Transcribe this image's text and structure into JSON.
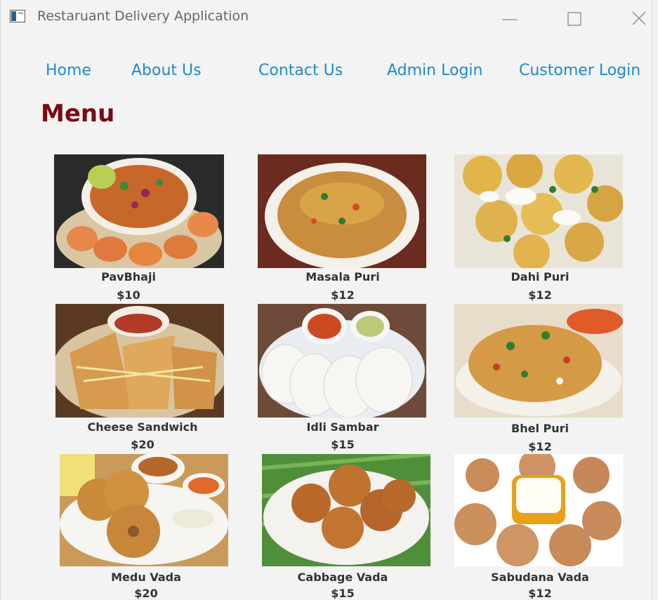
{
  "window": {
    "title": "Restaruant Delivery Application"
  },
  "nav": {
    "home": "Home",
    "about": "About Us",
    "contact": "Contact Us",
    "admin_login": "Admin Login",
    "customer_login": "Customer Login"
  },
  "menu": {
    "heading": "Menu",
    "items": [
      {
        "name": "PavBhaji",
        "price": "$10",
        "image": "pav-bhaji-photo"
      },
      {
        "name": "Masala Puri",
        "price": "$12",
        "image": "masala-puri-photo"
      },
      {
        "name": "Dahi Puri",
        "price": "$12",
        "image": "dahi-puri-photo"
      },
      {
        "name": "Cheese Sandwich",
        "price": "$20",
        "image": "cheese-sandwich-photo"
      },
      {
        "name": "Idli Sambar",
        "price": "$15",
        "image": "idli-sambar-photo"
      },
      {
        "name": "Bhel Puri",
        "price": "$12",
        "image": "bhel-puri-photo"
      },
      {
        "name": "Medu Vada",
        "price": "$20",
        "image": "medu-vada-photo"
      },
      {
        "name": "Cabbage Vada",
        "price": "$15",
        "image": "cabbage-vada-photo"
      },
      {
        "name": "Sabudana Vada",
        "price": "$12",
        "image": "sabudana-vada-photo"
      }
    ]
  },
  "colors": {
    "nav_link": "#1e8bc9",
    "heading": "#7b0a17",
    "background": "#f3f3f3"
  }
}
